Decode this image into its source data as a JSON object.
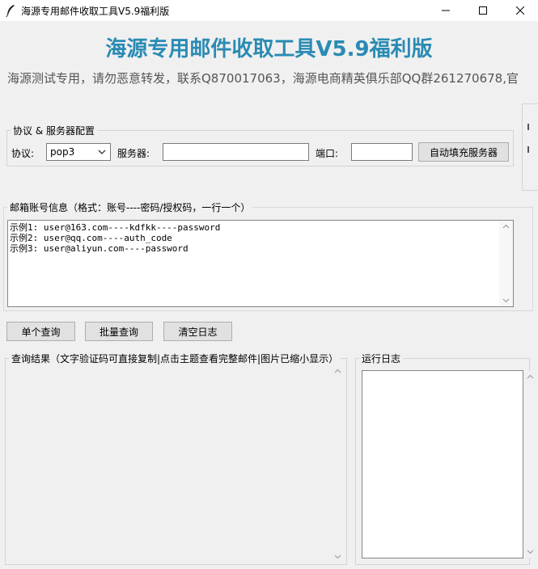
{
  "window": {
    "title": "海源专用邮件收取工具V5.9福利版",
    "controls": {
      "minimize_icon": "minimize-icon",
      "maximize_icon": "maximize-icon",
      "close_icon": "close-icon"
    }
  },
  "header": {
    "title": "海源专用邮件收取工具V5.9福利版",
    "subtitle": "海源测试专用，请勿恶意转发，联系Q870017063，海源电商精英俱乐部QQ群261270678,官",
    "title_color": "#2a8bb4"
  },
  "config": {
    "group_label": "协议 & 服务器配置",
    "protocol_label": "协议:",
    "protocol_value": "pop3",
    "server_label": "服务器:",
    "server_value": "",
    "port_label": "端口:",
    "port_value": "",
    "autofill_label": "自动填充服务器"
  },
  "accounts": {
    "label": "邮箱账号信息（格式：账号----密码/授权码，一行一个）",
    "lines": [
      "示例1: user@163.com----kdfkk----password",
      "示例2: user@qq.com----auth_code",
      "示例3: user@aliyun.com----password"
    ]
  },
  "actions": {
    "single_query": "单个查询",
    "batch_query": "批量查询",
    "clear_log": "清空日志"
  },
  "results": {
    "label": "查询结果（文字验证码可直接复制|点击主题查看完整邮件|图片已缩小显示）"
  },
  "log": {
    "label": "运行日志"
  }
}
